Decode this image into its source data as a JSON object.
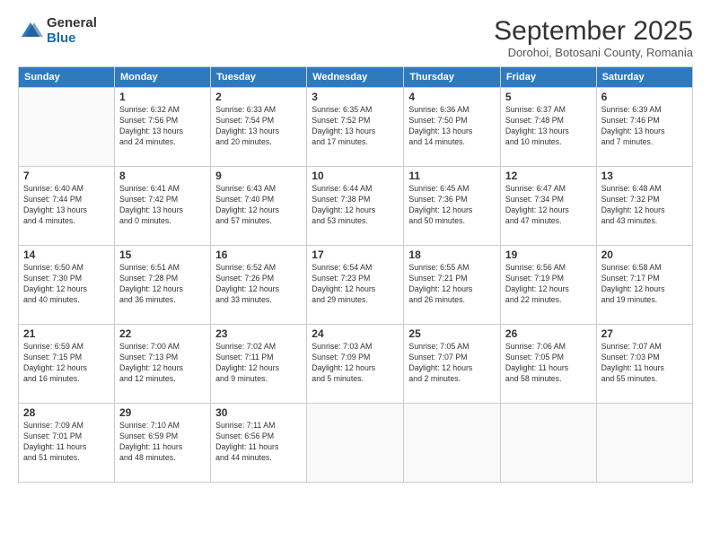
{
  "logo": {
    "general": "General",
    "blue": "Blue"
  },
  "title": "September 2025",
  "subtitle": "Dorohoi, Botosani County, Romania",
  "headers": [
    "Sunday",
    "Monday",
    "Tuesday",
    "Wednesday",
    "Thursday",
    "Friday",
    "Saturday"
  ],
  "weeks": [
    [
      {
        "day": "",
        "info": ""
      },
      {
        "day": "1",
        "info": "Sunrise: 6:32 AM\nSunset: 7:56 PM\nDaylight: 13 hours\nand 24 minutes."
      },
      {
        "day": "2",
        "info": "Sunrise: 6:33 AM\nSunset: 7:54 PM\nDaylight: 13 hours\nand 20 minutes."
      },
      {
        "day": "3",
        "info": "Sunrise: 6:35 AM\nSunset: 7:52 PM\nDaylight: 13 hours\nand 17 minutes."
      },
      {
        "day": "4",
        "info": "Sunrise: 6:36 AM\nSunset: 7:50 PM\nDaylight: 13 hours\nand 14 minutes."
      },
      {
        "day": "5",
        "info": "Sunrise: 6:37 AM\nSunset: 7:48 PM\nDaylight: 13 hours\nand 10 minutes."
      },
      {
        "day": "6",
        "info": "Sunrise: 6:39 AM\nSunset: 7:46 PM\nDaylight: 13 hours\nand 7 minutes."
      }
    ],
    [
      {
        "day": "7",
        "info": "Sunrise: 6:40 AM\nSunset: 7:44 PM\nDaylight: 13 hours\nand 4 minutes."
      },
      {
        "day": "8",
        "info": "Sunrise: 6:41 AM\nSunset: 7:42 PM\nDaylight: 13 hours\nand 0 minutes."
      },
      {
        "day": "9",
        "info": "Sunrise: 6:43 AM\nSunset: 7:40 PM\nDaylight: 12 hours\nand 57 minutes."
      },
      {
        "day": "10",
        "info": "Sunrise: 6:44 AM\nSunset: 7:38 PM\nDaylight: 12 hours\nand 53 minutes."
      },
      {
        "day": "11",
        "info": "Sunrise: 6:45 AM\nSunset: 7:36 PM\nDaylight: 12 hours\nand 50 minutes."
      },
      {
        "day": "12",
        "info": "Sunrise: 6:47 AM\nSunset: 7:34 PM\nDaylight: 12 hours\nand 47 minutes."
      },
      {
        "day": "13",
        "info": "Sunrise: 6:48 AM\nSunset: 7:32 PM\nDaylight: 12 hours\nand 43 minutes."
      }
    ],
    [
      {
        "day": "14",
        "info": "Sunrise: 6:50 AM\nSunset: 7:30 PM\nDaylight: 12 hours\nand 40 minutes."
      },
      {
        "day": "15",
        "info": "Sunrise: 6:51 AM\nSunset: 7:28 PM\nDaylight: 12 hours\nand 36 minutes."
      },
      {
        "day": "16",
        "info": "Sunrise: 6:52 AM\nSunset: 7:26 PM\nDaylight: 12 hours\nand 33 minutes."
      },
      {
        "day": "17",
        "info": "Sunrise: 6:54 AM\nSunset: 7:23 PM\nDaylight: 12 hours\nand 29 minutes."
      },
      {
        "day": "18",
        "info": "Sunrise: 6:55 AM\nSunset: 7:21 PM\nDaylight: 12 hours\nand 26 minutes."
      },
      {
        "day": "19",
        "info": "Sunrise: 6:56 AM\nSunset: 7:19 PM\nDaylight: 12 hours\nand 22 minutes."
      },
      {
        "day": "20",
        "info": "Sunrise: 6:58 AM\nSunset: 7:17 PM\nDaylight: 12 hours\nand 19 minutes."
      }
    ],
    [
      {
        "day": "21",
        "info": "Sunrise: 6:59 AM\nSunset: 7:15 PM\nDaylight: 12 hours\nand 16 minutes."
      },
      {
        "day": "22",
        "info": "Sunrise: 7:00 AM\nSunset: 7:13 PM\nDaylight: 12 hours\nand 12 minutes."
      },
      {
        "day": "23",
        "info": "Sunrise: 7:02 AM\nSunset: 7:11 PM\nDaylight: 12 hours\nand 9 minutes."
      },
      {
        "day": "24",
        "info": "Sunrise: 7:03 AM\nSunset: 7:09 PM\nDaylight: 12 hours\nand 5 minutes."
      },
      {
        "day": "25",
        "info": "Sunrise: 7:05 AM\nSunset: 7:07 PM\nDaylight: 12 hours\nand 2 minutes."
      },
      {
        "day": "26",
        "info": "Sunrise: 7:06 AM\nSunset: 7:05 PM\nDaylight: 11 hours\nand 58 minutes."
      },
      {
        "day": "27",
        "info": "Sunrise: 7:07 AM\nSunset: 7:03 PM\nDaylight: 11 hours\nand 55 minutes."
      }
    ],
    [
      {
        "day": "28",
        "info": "Sunrise: 7:09 AM\nSunset: 7:01 PM\nDaylight: 11 hours\nand 51 minutes."
      },
      {
        "day": "29",
        "info": "Sunrise: 7:10 AM\nSunset: 6:59 PM\nDaylight: 11 hours\nand 48 minutes."
      },
      {
        "day": "30",
        "info": "Sunrise: 7:11 AM\nSunset: 6:56 PM\nDaylight: 11 hours\nand 44 minutes."
      },
      {
        "day": "",
        "info": ""
      },
      {
        "day": "",
        "info": ""
      },
      {
        "day": "",
        "info": ""
      },
      {
        "day": "",
        "info": ""
      }
    ]
  ]
}
